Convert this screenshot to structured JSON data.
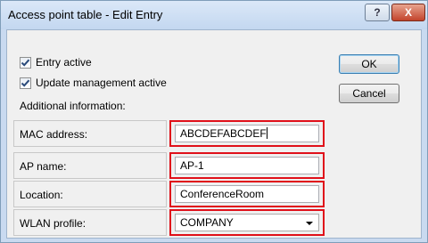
{
  "window": {
    "title": "Access point table - Edit Entry",
    "help_label": "?",
    "close_label": "X"
  },
  "options": {
    "entry_active": {
      "label": "Entry active",
      "checked": true
    },
    "update_management_active": {
      "label": "Update management active",
      "checked": true
    },
    "additional_information_label": "Additional information:"
  },
  "buttons": {
    "ok": "OK",
    "cancel": "Cancel"
  },
  "fields": {
    "mac_address": {
      "label": "MAC address:",
      "value": "ABCDEFABCDEF"
    },
    "ap_name": {
      "label": "AP name:",
      "value": "AP-1"
    },
    "location": {
      "label": "Location:",
      "value": "ConferenceRoom"
    },
    "wlan_profile": {
      "label": "WLAN profile:",
      "value": "COMPANY"
    }
  },
  "colors": {
    "highlight": "#e0101a",
    "title_bar": "#c9daf0",
    "close_button": "#c2442c"
  }
}
